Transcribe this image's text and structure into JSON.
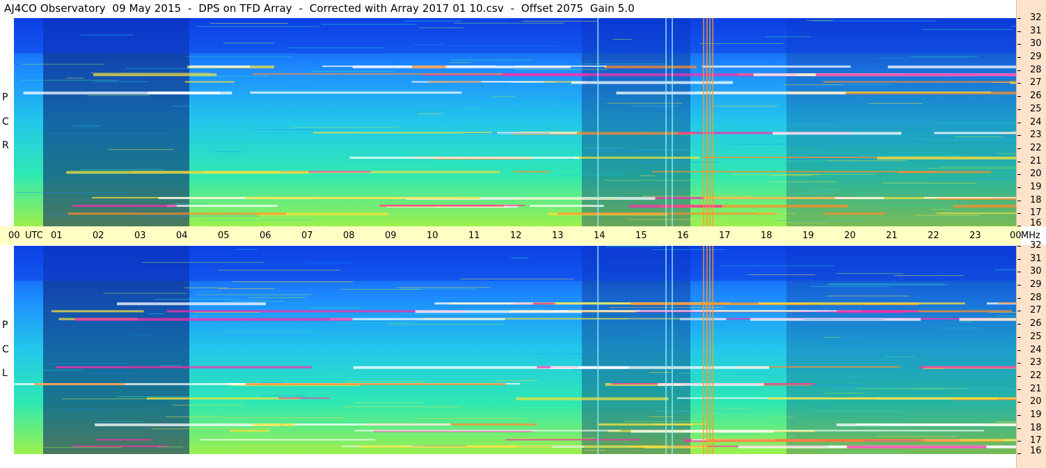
{
  "title": "AJ4CO Observatory  09 May 2015  -  DPS on TFD Array  -  Corrected with Array 2017 01 10.csv  -  Offset 2075  Gain 5.0",
  "chart_data": {
    "type": "heatmap",
    "title": "AJ4CO Observatory  09 May 2015  -  DPS on TFD Array  -  Corrected with Array 2017 01 10.csv  -  Offset 2075  Gain 5.0",
    "xlabel": "UTC",
    "ylabel": "MHz",
    "x_ticks": [
      "00",
      "01",
      "02",
      "03",
      "04",
      "05",
      "06",
      "07",
      "08",
      "09",
      "10",
      "11",
      "12",
      "13",
      "14",
      "15",
      "16",
      "17",
      "18",
      "19",
      "20",
      "21",
      "22",
      "23",
      "00"
    ],
    "xlim_hours_utc": [
      0,
      24
    ],
    "y_ticks": [
      32,
      31,
      30,
      29,
      28,
      27,
      26,
      25,
      24,
      23,
      22,
      21,
      20,
      19,
      18,
      17,
      16
    ],
    "ylim_mhz": [
      16,
      32
    ],
    "colormap": [
      "#0a1a6e",
      "#0c40e6",
      "#1e8cff",
      "#22c8ea",
      "#2ee8b4",
      "#9cf04c",
      "#f6e23c",
      "#ff8c2a",
      "#ff2ea8",
      "#ffffff"
    ],
    "panels": [
      {
        "name": "R C P",
        "label_letters": [
          "R",
          "C",
          "P"
        ],
        "bright_bands_mhz": [
          17.0,
          17.6,
          18.2,
          20.2,
          21.3,
          23.2,
          26.3,
          27.1,
          27.7,
          28.3
        ],
        "vertical_interference_utc": [
          13.97,
          15.6,
          15.75,
          16.5,
          16.58,
          16.65,
          16.72
        ]
      },
      {
        "name": "L C P",
        "label_letters": [
          "L",
          "C",
          "P"
        ],
        "bright_bands_mhz": [
          16.6,
          17.1,
          17.8,
          18.3,
          20.3,
          21.4,
          22.7,
          26.4,
          27.0,
          27.6
        ],
        "vertical_interference_utc": [
          13.97,
          15.6,
          15.75,
          16.5,
          16.58,
          16.65,
          16.72
        ]
      }
    ],
    "grid": false,
    "legend": "none"
  },
  "time_axis": {
    "ticks": [
      "00",
      "01",
      "02",
      "03",
      "04",
      "05",
      "06",
      "07",
      "08",
      "09",
      "10",
      "11",
      "12",
      "13",
      "14",
      "15",
      "16",
      "17",
      "18",
      "19",
      "20",
      "21",
      "22",
      "23",
      "00"
    ],
    "utc_label": "UTC",
    "mhz_label": "MHz"
  },
  "freq_axis": {
    "labels": [
      "32",
      "31",
      "30",
      "29",
      "28",
      "27",
      "26",
      "25",
      "24",
      "23",
      "22",
      "21",
      "20",
      "19",
      "18",
      "17",
      "16"
    ]
  }
}
